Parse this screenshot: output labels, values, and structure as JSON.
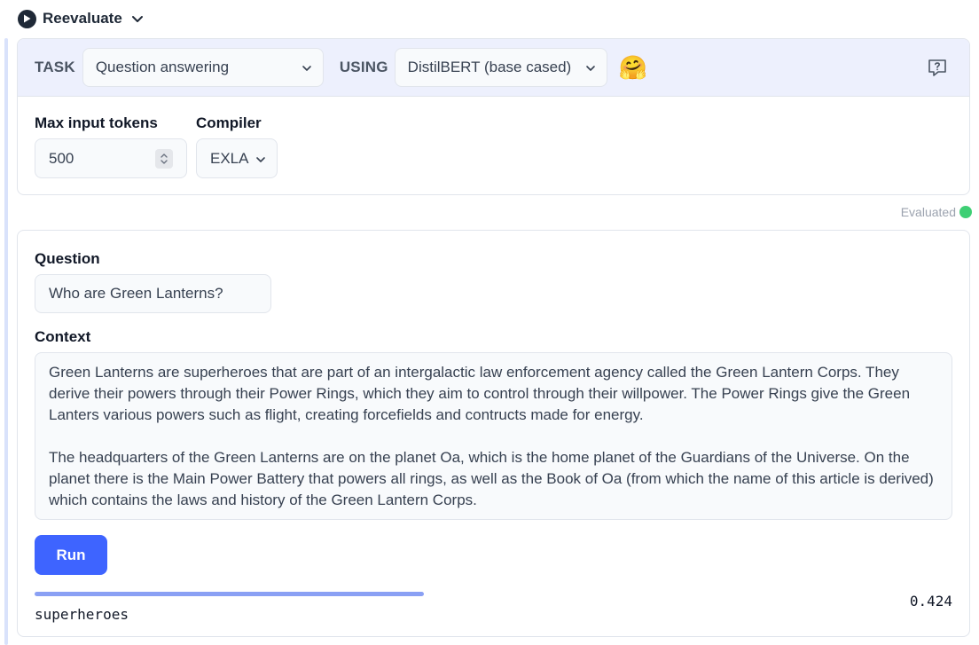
{
  "cell": {
    "reevaluate_label": "Reevaluate"
  },
  "setup": {
    "task_label": "TASK",
    "task_value": "Question answering",
    "using_label": "USING",
    "model_value": "DistilBERT (base cased)",
    "model_emoji": "🤗",
    "max_tokens_label": "Max input tokens",
    "max_tokens_value": "500",
    "compiler_label": "Compiler",
    "compiler_value": "EXLA"
  },
  "status": {
    "text": "Evaluated",
    "color": "#3ecf74"
  },
  "form": {
    "question_label": "Question",
    "question_value": "Who are Green Lanterns?",
    "context_label": "Context",
    "context_paragraphs": [
      "Green Lanterns are superheroes that are part of an intergalactic law enforcement agency called the Green Lantern Corps. They derive their powers through their Power Rings, which they aim to control through their willpower. The Power Rings give the Green Lanters various powers such as flight, creating forcefields and contructs made for energy.",
      "The headquarters of the Green Lanterns are on the planet Oa, which is the home planet of the Guardians of the Universe. On the planet there is the Main Power Battery that powers all rings, as well as the Book of Oa (from which the name of this article is derived) which contains the laws and history of the Green Lantern Corps."
    ],
    "run_label": "Run"
  },
  "result": {
    "answer": "superheroes",
    "score": "0.424",
    "score_value": 0.424
  },
  "colors": {
    "accent": "#3e64ff",
    "header_bg": "#edf0fd",
    "score_bar": "#8aa0f4"
  }
}
